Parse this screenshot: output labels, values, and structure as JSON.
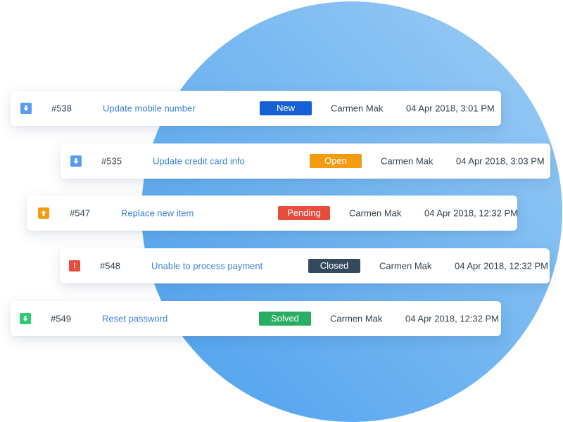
{
  "colors": {
    "circle_gradient": [
      "#4da0ee",
      "#9cccf4"
    ],
    "subject_link": "#3b82d6",
    "status_new": "#1660d6",
    "status_open": "#f39c12",
    "status_pending": "#e74c3c",
    "status_closed": "#34495e",
    "status_solved": "#27ae60"
  },
  "tickets": [
    {
      "priority_icon": "arrow-down-icon",
      "priority_color": "#5b9bf0",
      "id": "#538",
      "subject": "Update mobile number",
      "status": "New",
      "requester": "Carmen Mak",
      "date": "04 Apr 2018, 3:01 PM"
    },
    {
      "priority_icon": "arrow-down-icon",
      "priority_color": "#5b9bf0",
      "id": "#535",
      "subject": "Update credit card info",
      "status": "Open",
      "requester": "Carmen Mak",
      "date": "04 Apr 2018, 3:03 PM"
    },
    {
      "priority_icon": "arrow-up-icon",
      "priority_color": "#f39c12",
      "id": "#547",
      "subject": "Replace new item",
      "status": "Pending",
      "requester": "Carmen Mak",
      "date": "04 Apr 2018, 12:32 PM"
    },
    {
      "priority_icon": "exclamation-icon",
      "priority_color": "#e74c3c",
      "priority_glyph": "!",
      "id": "#548",
      "subject": "Unable to process payment",
      "status": "Closed",
      "requester": "Carmen Mak",
      "date": "04 Apr 2018, 12:32 PM"
    },
    {
      "priority_icon": "arrow-down-icon",
      "priority_color": "#2ecc71",
      "id": "#549",
      "subject": "Reset password",
      "status": "Solved",
      "requester": "Carmen Mak",
      "date": "04 Apr 2018, 12:32 PM"
    }
  ]
}
